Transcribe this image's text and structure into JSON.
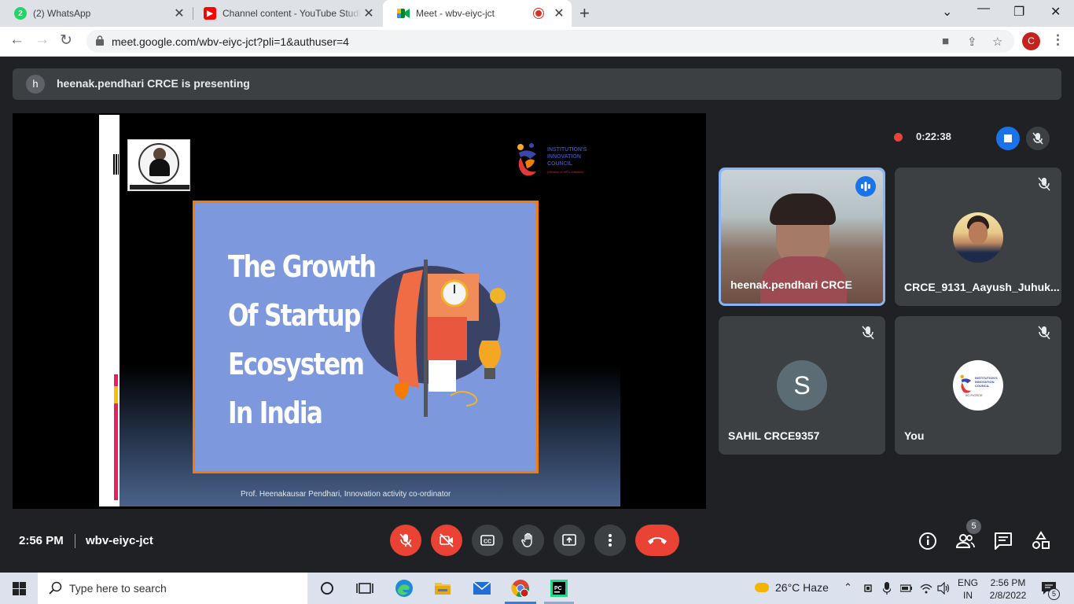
{
  "browser": {
    "tabs": [
      {
        "label": "(2) WhatsApp",
        "icon": "whatsapp-icon",
        "active": false
      },
      {
        "label": "Channel content - YouTube Studio",
        "icon": "youtube-icon",
        "active": false
      },
      {
        "label": "Meet - wbv-eiyc-jct",
        "icon": "google-meet-icon",
        "active": true
      }
    ],
    "url": "meet.google.com/wbv-eiyc-jct?pli=1&authuser=4",
    "profile_initial": "C"
  },
  "meet": {
    "presenting_avatar": "h",
    "presenting_text": "heenak.pendhari CRCE is presenting",
    "recording_time": "0:22:38",
    "slide": {
      "title_lines": [
        "The Growth",
        "Of Startup",
        "Ecosystem",
        "In India"
      ],
      "footer": "Prof. Heenakausar Pendhari,     Innovation activity co-ordinator",
      "iic_lines": [
        "INSTITUTION'S",
        "INNOVATION",
        "COUNCIL"
      ],
      "iic_sub": "(Ministry of HRD Initiative)"
    },
    "participants": [
      {
        "name": "heenak.pendhari CRCE",
        "speaking": true
      },
      {
        "name": "CRCE_9131_Aayush_Juhuk...",
        "speaking": false
      },
      {
        "name": "SAHIL CRCE9357",
        "initial": "S",
        "speaking": false
      },
      {
        "name": "You",
        "speaking": false
      }
    ],
    "you_logo_lines": [
      "INSTITUTION'S",
      "INNOVATION",
      "COUNCIL"
    ],
    "you_logo_sub": "IIC-FrCRCE",
    "time": "2:56 PM",
    "meeting_code": "wbv-eiyc-jct",
    "participant_count": "5"
  },
  "taskbar": {
    "search_placeholder": "Type here to search",
    "weather": "26°C  Haze",
    "lang_line1": "ENG",
    "lang_line2": "IN",
    "time": "2:56 PM",
    "date": "2/8/2022",
    "notification_count": "5"
  },
  "colors": {
    "meet_bg": "#202124",
    "tile_bg": "#3c4043",
    "red": "#ea4335",
    "blue": "#1a73e8",
    "slide_panel": "#7d98dd",
    "slide_border": "#f57c00"
  }
}
